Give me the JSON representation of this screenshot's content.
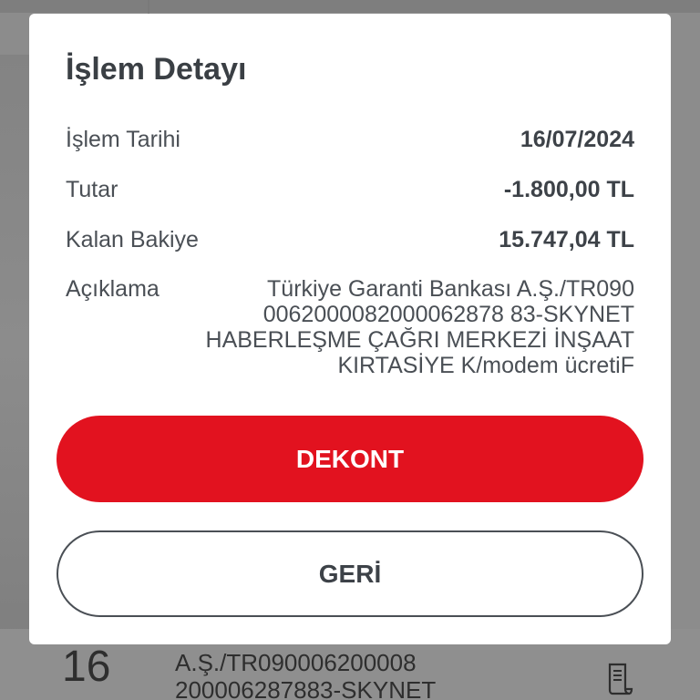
{
  "background": {
    "row_day": "16",
    "row_description": "A.Ş./TR090006200008\n200006287883-SKYNET",
    "receipt_icon": "receipt-icon"
  },
  "dialog": {
    "title": "İşlem Detayı",
    "fields": {
      "date_label": "İşlem Tarihi",
      "date_value": "16/07/2024",
      "amount_label": "Tutar",
      "amount_value": "-1.800,00 TL",
      "balance_label": "Kalan Bakiye",
      "balance_value": "15.747,04 TL",
      "description_label": "Açıklama",
      "description_value": "Türkiye Garanti Bankası A.Ş./TR090\n0062000082000062878 83-SKYNET\nHABERLEŞME ÇAĞRI MERKEZİ İNŞAAT\nKIRTASİYE K/modem ücretiF"
    },
    "buttons": {
      "receipt": "DEKONT",
      "back": "GERİ"
    }
  },
  "colors": {
    "primary": "#e2121f",
    "text_dark": "#3d4248",
    "overlay": "#8c8c8c"
  }
}
